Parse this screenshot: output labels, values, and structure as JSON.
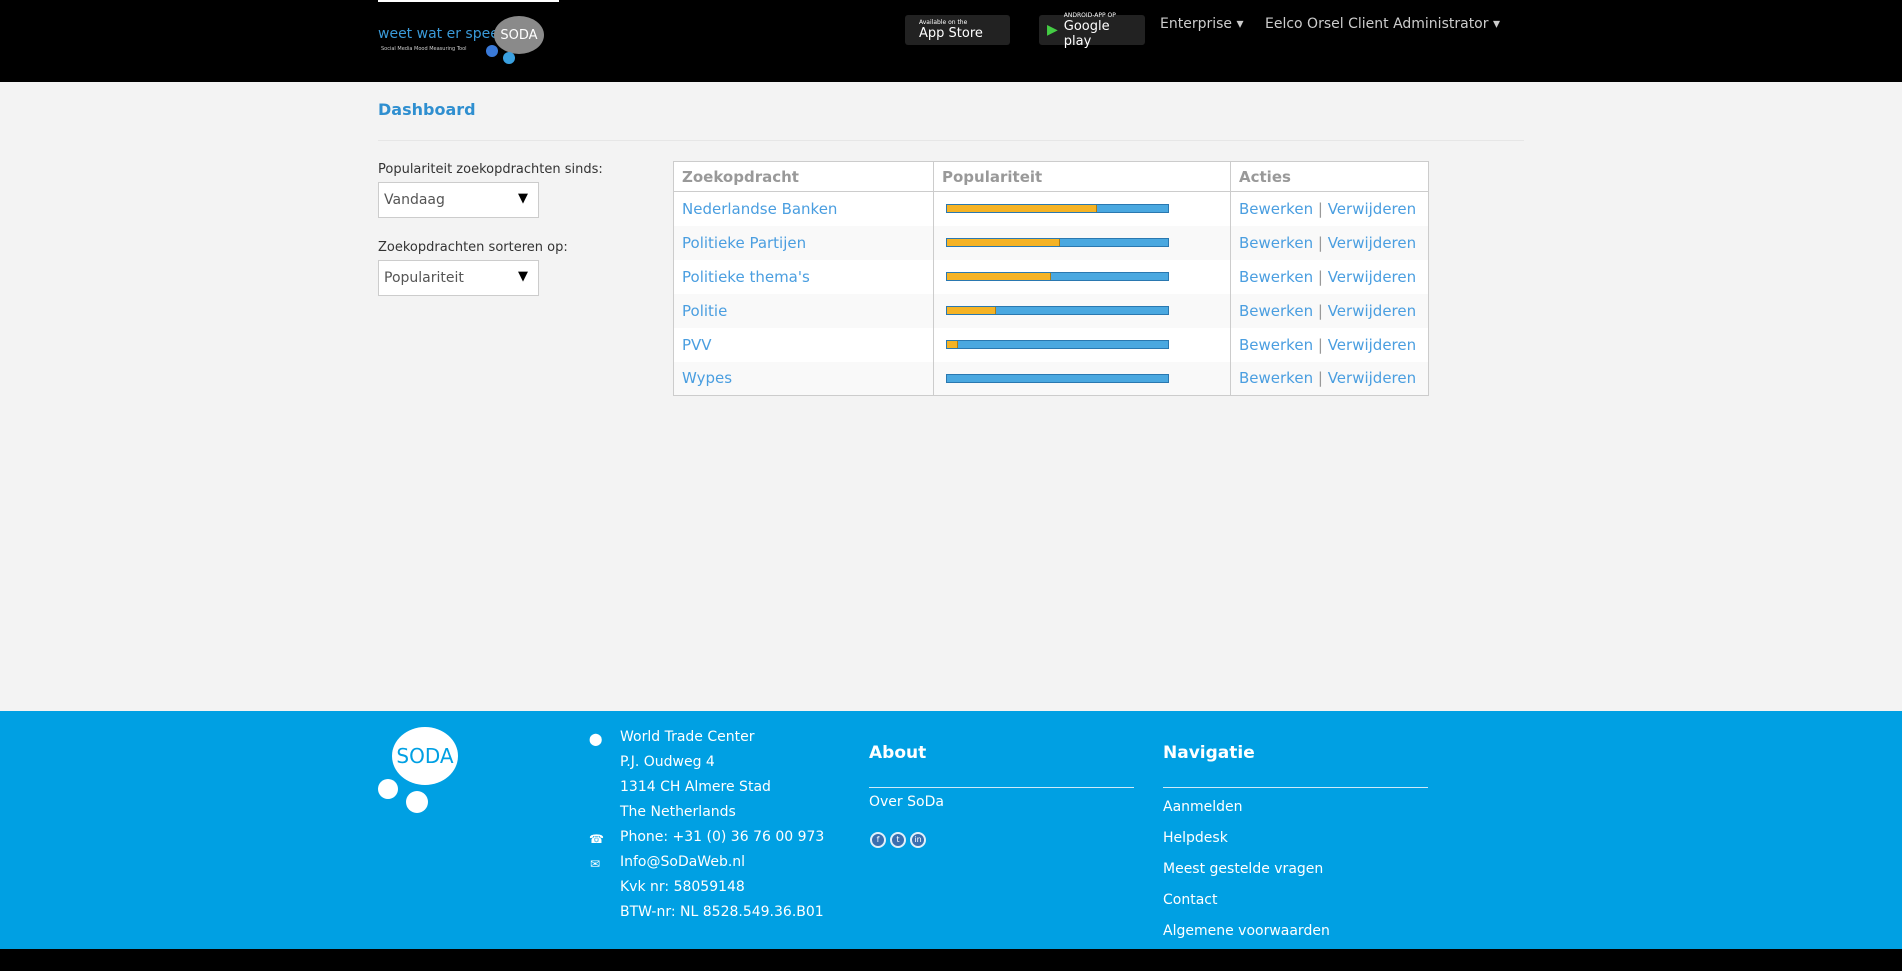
{
  "header": {
    "logo_text": "weet wat er speelt",
    "logo_sub": "Social Media Mood Measuring Tool",
    "logo_mark": "SODA",
    "appstore": {
      "small": "Available on the",
      "big": "App Store"
    },
    "googleplay": {
      "small": "ANDROID-APP OP",
      "big": "Google play"
    },
    "nav": [
      {
        "label": "Enterprise ▾"
      },
      {
        "label": "Eelco Orsel Client Administrator ▾"
      }
    ]
  },
  "page": {
    "title": "Dashboard"
  },
  "filters": {
    "since_label": "Populariteit zoekopdrachten sinds:",
    "since_value": "Vandaag",
    "sort_label": "Zoekopdrachten sorteren op:",
    "sort_value": "Populariteit"
  },
  "table": {
    "headers": [
      "Zoekopdracht",
      "Populariteit",
      "Acties"
    ],
    "edit": "Bewerken",
    "sep": "|",
    "delete": "Verwijderen",
    "rows": [
      {
        "name": "Nederlandse Banken",
        "popularity": 0.68
      },
      {
        "name": "Politieke Partijen",
        "popularity": 0.51
      },
      {
        "name": "Politieke thema's",
        "popularity": 0.47
      },
      {
        "name": "Politie",
        "popularity": 0.22
      },
      {
        "name": "PVV",
        "popularity": 0.05
      },
      {
        "name": "Wypes",
        "popularity": 0
      }
    ]
  },
  "colors": {
    "bar_fill": "#f5b325",
    "bar_bg": "#4aa8e0",
    "footer": "#00a0e3",
    "link": "#4a9ee0"
  },
  "footer": {
    "logo": "SODA",
    "address": [
      "World Trade Center",
      "P.J. Oudweg 4",
      "1314 CH Almere Stad",
      "The Netherlands"
    ],
    "phone": "Phone: +31 (0) 36 76 00 973",
    "email": "Info@SoDaWeb.nl",
    "kvk": "Kvk nr: 58059148",
    "btw": "BTW-nr: NL 8528.549.36.B01",
    "about_title": "About",
    "about_links": [
      "Over SoDa"
    ],
    "social": [
      "facebook",
      "twitter",
      "linkedin"
    ],
    "nav_title": "Navigatie",
    "nav_links": [
      "Aanmelden",
      "Helpdesk",
      "Meest gestelde vragen",
      "Contact",
      "Algemene voorwaarden"
    ]
  }
}
